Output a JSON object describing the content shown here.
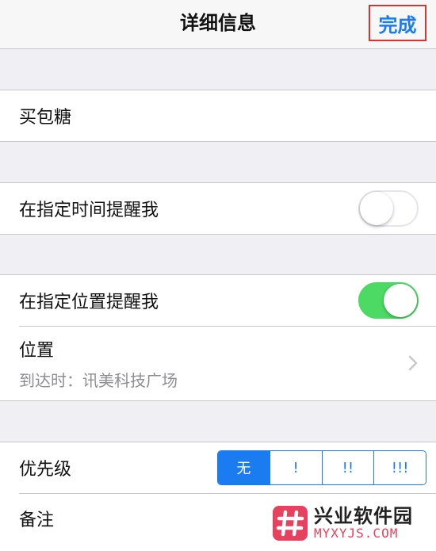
{
  "navbar": {
    "title": "详细信息",
    "done_label": "完成"
  },
  "task": {
    "title": "买包糖"
  },
  "time_reminder": {
    "label": "在指定时间提醒我",
    "enabled": false
  },
  "location_reminder": {
    "label": "在指定位置提醒我",
    "enabled": true,
    "location_label": "位置",
    "location_value": "到达时：讯美科技广场"
  },
  "priority": {
    "label": "优先级",
    "options": [
      "无",
      "!",
      "!!",
      "!!!"
    ],
    "selected": "无"
  },
  "notes": {
    "label": "备注"
  },
  "watermark": {
    "name": "兴业软件园",
    "domain": "MYXYJS.COM"
  },
  "colors": {
    "accent": "#1a7cf0",
    "switch_on": "#4cd964",
    "highlight_border": "#e03131",
    "watermark_red": "#e8415f"
  }
}
